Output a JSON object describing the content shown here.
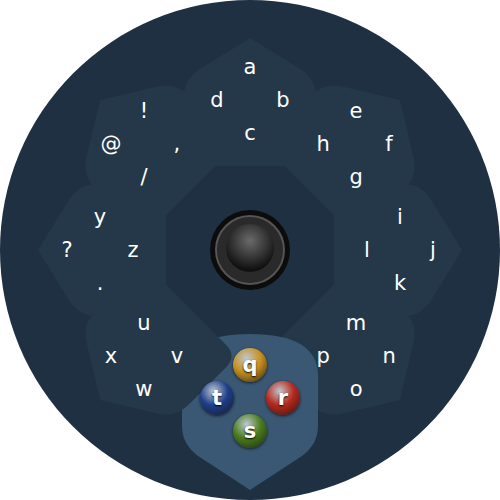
{
  "petals": [
    {
      "selected": false,
      "keys": [
        {
          "label": "a"
        },
        {
          "label": "d"
        },
        {
          "label": "b"
        },
        {
          "label": "c"
        }
      ]
    },
    {
      "selected": false,
      "keys": [
        {
          "label": "e"
        },
        {
          "label": "h"
        },
        {
          "label": "f"
        },
        {
          "label": "g"
        }
      ]
    },
    {
      "selected": false,
      "keys": [
        {
          "label": "i"
        },
        {
          "label": "l"
        },
        {
          "label": "j"
        },
        {
          "label": "k"
        }
      ]
    },
    {
      "selected": false,
      "keys": [
        {
          "label": "m"
        },
        {
          "label": "p"
        },
        {
          "label": "n"
        },
        {
          "label": "o"
        }
      ]
    },
    {
      "selected": true,
      "keys": [
        {
          "label": "q",
          "color": "#c8901e"
        },
        {
          "label": "t",
          "color": "#1f3f8c"
        },
        {
          "label": "r",
          "color": "#b8281c"
        },
        {
          "label": "s",
          "color": "#4c7d1c"
        }
      ]
    },
    {
      "selected": false,
      "keys": [
        {
          "label": "u"
        },
        {
          "label": "x"
        },
        {
          "label": "v"
        },
        {
          "label": "w"
        }
      ]
    },
    {
      "selected": false,
      "keys": [
        {
          "label": "y"
        },
        {
          "label": "?"
        },
        {
          "label": "z"
        },
        {
          "label": "."
        }
      ]
    },
    {
      "selected": false,
      "keys": [
        {
          "label": "!"
        },
        {
          "label": "@"
        },
        {
          "label": ","
        },
        {
          "label": "/"
        }
      ]
    }
  ]
}
